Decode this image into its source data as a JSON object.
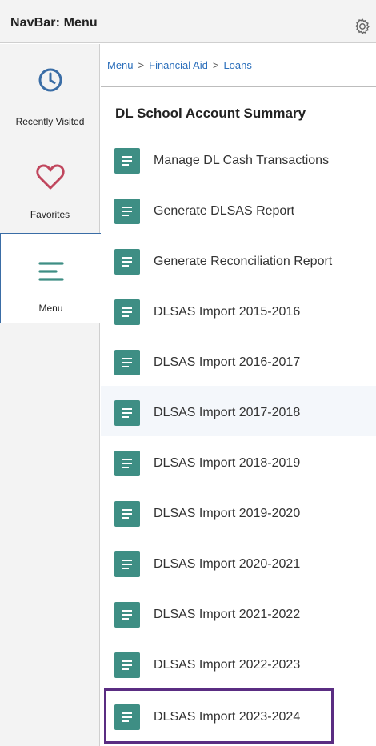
{
  "header": {
    "title": "NavBar: Menu",
    "settings_icon": "gear-icon"
  },
  "sidebar": {
    "items": [
      {
        "label": "Recently Visited",
        "icon": "clock-icon"
      },
      {
        "label": "Favorites",
        "icon": "heart-icon"
      },
      {
        "label": "Menu",
        "icon": "menu-lines-icon",
        "active": true
      }
    ]
  },
  "breadcrumb": {
    "items": [
      "Menu",
      "Financial Aid",
      "Loans"
    ],
    "separator": ">"
  },
  "section": {
    "title": "DL School Account Summary"
  },
  "menu": {
    "items": [
      {
        "label": "Manage DL Cash Transactions"
      },
      {
        "label": "Generate DLSAS Report"
      },
      {
        "label": "Generate Reconciliation Report"
      },
      {
        "label": "DLSAS Import 2015-2016"
      },
      {
        "label": "DLSAS Import 2016-2017"
      },
      {
        "label": "DLSAS Import 2017-2018",
        "highlighted": true
      },
      {
        "label": "DLSAS Import 2018-2019"
      },
      {
        "label": "DLSAS Import 2019-2020"
      },
      {
        "label": "DLSAS Import 2020-2021"
      },
      {
        "label": "DLSAS Import 2021-2022"
      },
      {
        "label": "DLSAS Import 2022-2023"
      },
      {
        "label": "DLSAS Import 2023-2024",
        "boxed": true
      }
    ]
  },
  "colors": {
    "tile": "#3e8e84",
    "accent": "#2a6ebb",
    "box": "#5a2d82",
    "heart": "#c0465d",
    "clock": "#3a6da6"
  }
}
